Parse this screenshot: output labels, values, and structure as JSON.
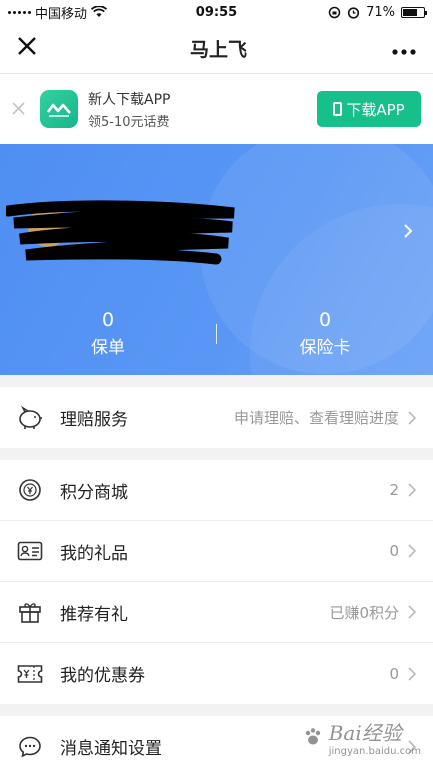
{
  "status_bar": {
    "carrier": "中国移动",
    "time": "09:55",
    "battery": "71%",
    "battery_level": 0.71
  },
  "nav": {
    "title": "马上飞"
  },
  "banner": {
    "title": "新人下载APP",
    "subtitle": "领5-10元话费",
    "button_label": "下载APP"
  },
  "hero": {
    "stats": [
      {
        "value": "0",
        "label": "保单"
      },
      {
        "value": "0",
        "label": "保险卡"
      }
    ]
  },
  "groups": [
    [
      {
        "icon": "piggy-bank-icon",
        "label": "理赔服务",
        "value": "申请理赔、查看理赔进度"
      }
    ],
    [
      {
        "icon": "coin-icon",
        "label": "积分商城",
        "value": "2"
      },
      {
        "icon": "id-card-icon",
        "label": "我的礼品",
        "value": "0"
      },
      {
        "icon": "gift-icon",
        "label": "推荐有礼",
        "value": "已赚0积分"
      },
      {
        "icon": "coupon-icon",
        "label": "我的优惠券",
        "value": "0"
      }
    ],
    [
      {
        "icon": "chat-bubble-icon",
        "label": "消息通知设置",
        "value": ""
      }
    ]
  ],
  "watermark": {
    "text": "Bai经验",
    "sub": "jingyan.baidu.com"
  }
}
